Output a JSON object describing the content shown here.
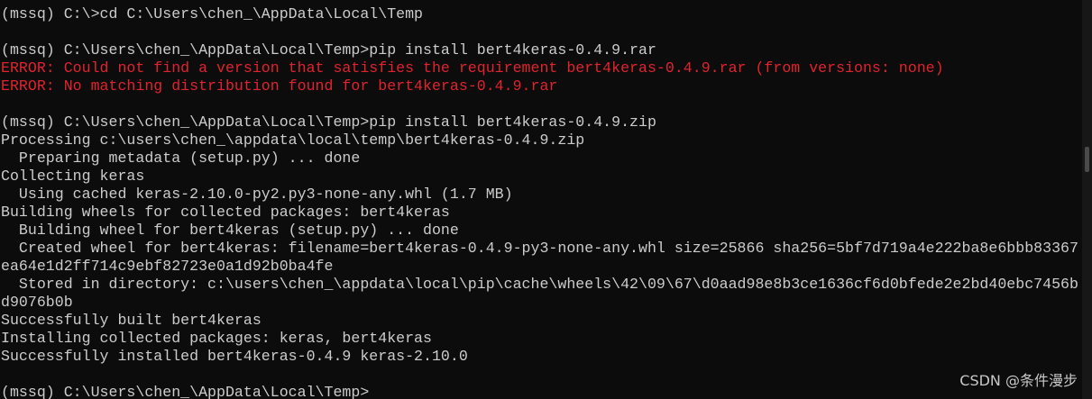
{
  "colors": {
    "background": "#0c0c0c",
    "text": "#cccccc",
    "error": "#e0232e"
  },
  "watermark": "CSDN @条件漫步",
  "lines": [
    {
      "text": "(mssq) C:\\>cd C:\\Users\\chen_\\AppData\\Local\\Temp",
      "kind": "prompt"
    },
    {
      "text": "",
      "kind": "blank"
    },
    {
      "text": "(mssq) C:\\Users\\chen_\\AppData\\Local\\Temp>pip install bert4keras-0.4.9.rar",
      "kind": "prompt"
    },
    {
      "text": "ERROR: Could not find a version that satisfies the requirement bert4keras-0.4.9.rar (from versions: none)",
      "kind": "error"
    },
    {
      "text": "ERROR: No matching distribution found for bert4keras-0.4.9.rar",
      "kind": "error"
    },
    {
      "text": "",
      "kind": "blank"
    },
    {
      "text": "(mssq) C:\\Users\\chen_\\AppData\\Local\\Temp>pip install bert4keras-0.4.9.zip",
      "kind": "prompt"
    },
    {
      "text": "Processing c:\\users\\chen_\\appdata\\local\\temp\\bert4keras-0.4.9.zip",
      "kind": "output"
    },
    {
      "text": "  Preparing metadata (setup.py) ... done",
      "kind": "output"
    },
    {
      "text": "Collecting keras",
      "kind": "output"
    },
    {
      "text": "  Using cached keras-2.10.0-py2.py3-none-any.whl (1.7 MB)",
      "kind": "output"
    },
    {
      "text": "Building wheels for collected packages: bert4keras",
      "kind": "output"
    },
    {
      "text": "  Building wheel for bert4keras (setup.py) ... done",
      "kind": "output"
    },
    {
      "text": "  Created wheel for bert4keras: filename=bert4keras-0.4.9-py3-none-any.whl size=25866 sha256=5bf7d719a4e222ba8e6bbb83367",
      "kind": "output"
    },
    {
      "text": "ea64e1d2ff714c9ebf82723e0a1d92b0ba4fe",
      "kind": "output"
    },
    {
      "text": "  Stored in directory: c:\\users\\chen_\\appdata\\local\\pip\\cache\\wheels\\42\\09\\67\\d0aad98e8b3ce1636cf6d0bfede2e2bd40ebc7456b",
      "kind": "output"
    },
    {
      "text": "d9076b0b",
      "kind": "output"
    },
    {
      "text": "Successfully built bert4keras",
      "kind": "output"
    },
    {
      "text": "Installing collected packages: keras, bert4keras",
      "kind": "output"
    },
    {
      "text": "Successfully installed bert4keras-0.4.9 keras-2.10.0",
      "kind": "output"
    },
    {
      "text": "",
      "kind": "blank"
    },
    {
      "text": "(mssq) C:\\Users\\chen_\\AppData\\Local\\Temp>",
      "kind": "prompt"
    }
  ]
}
